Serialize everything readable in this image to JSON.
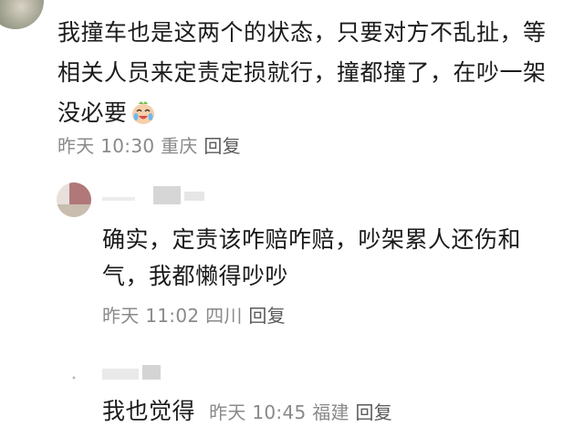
{
  "comment_main": {
    "text": "我撞车也是这两个的状态，只要对方不乱扯，等相关人员来定责定损就行，撞都撞了，在吵一架没必要",
    "emoji": "crying-laughing-emoji",
    "time": "昨天 10:30",
    "location": "重庆",
    "reply_label": "回复"
  },
  "reply_1": {
    "text": "确实，定责该咋赔咋赔，吵架累人还伤和气，我都懒得吵吵",
    "time": "昨天 11:02",
    "location": "四川",
    "reply_label": "回复"
  },
  "reply_2": {
    "text": "我也觉得",
    "time": "昨天 10:45",
    "location": "福建",
    "reply_label": "回复"
  }
}
